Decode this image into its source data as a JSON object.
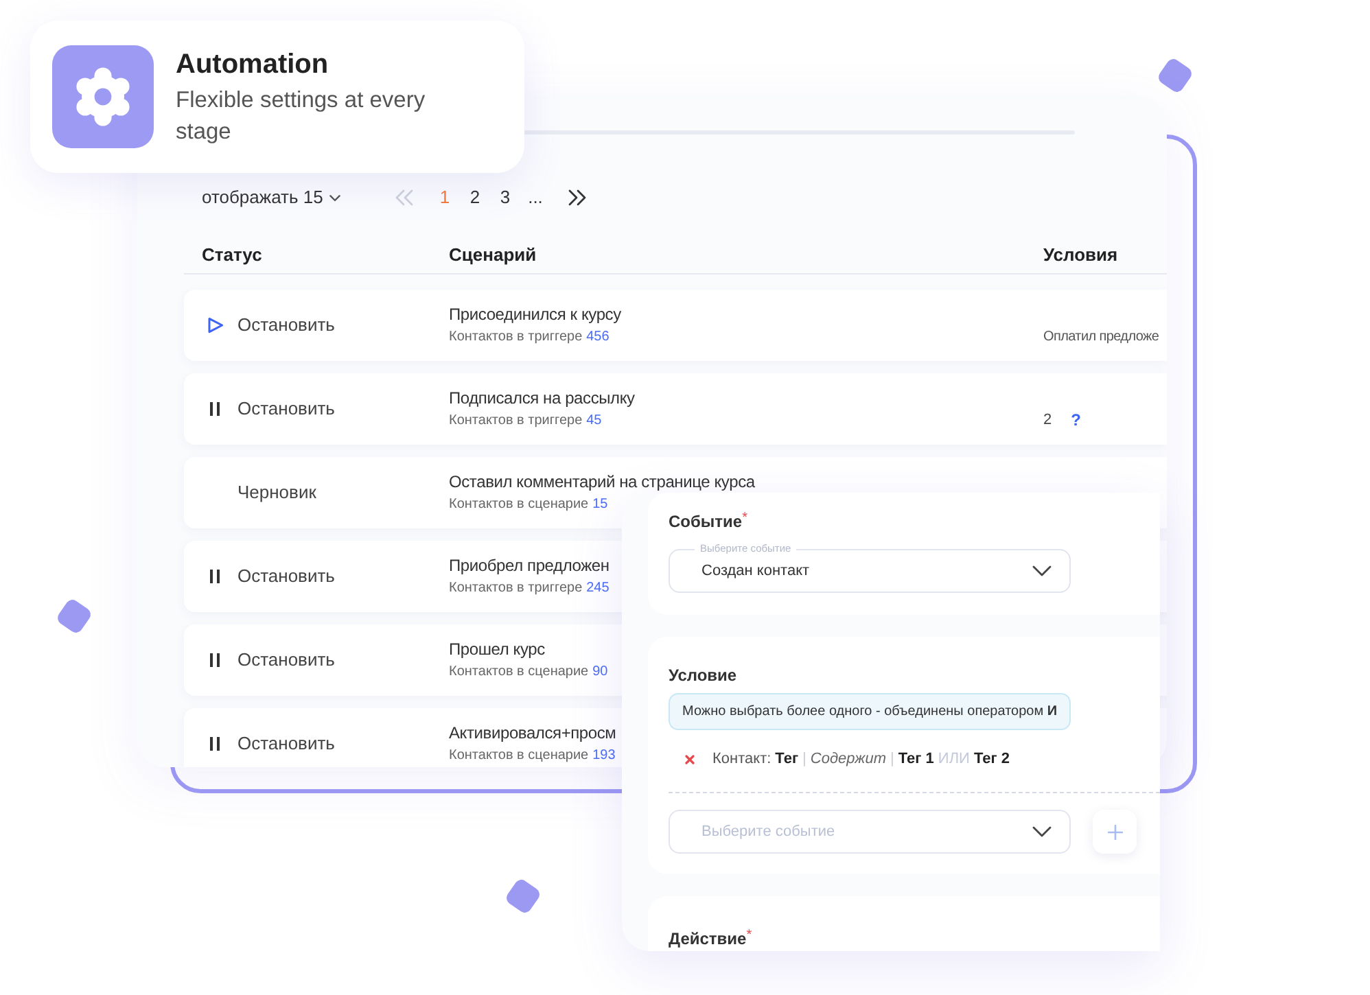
{
  "feature_card": {
    "title": "Automation",
    "subtitle": "Flexible settings at every stage"
  },
  "scenario_table": {
    "pagination": {
      "per_page": "отображать 15",
      "first_disabled": true,
      "last_disabled": false,
      "pages": [
        {
          "label": "1",
          "selected": true
        },
        {
          "label": "2",
          "selected": false
        },
        {
          "label": "3",
          "selected": false
        },
        {
          "label": "...",
          "selected": false
        }
      ]
    },
    "columns": [
      "Статус",
      "Сценарий",
      "Условия"
    ],
    "rows": [
      {
        "status": {
          "kind": "play",
          "label": "Остановить"
        },
        "title": "Присоединился к курсу",
        "counter_label": "Контактов в триггере",
        "counter_value": "456",
        "conditions": {
          "kind": "text",
          "text": "Оплатил предложе"
        }
      },
      {
        "status": {
          "kind": "pause",
          "label": "Остановить"
        },
        "title": "Подписался на рассылку",
        "counter_label": "Контактов в триггере",
        "counter_value": "45",
        "conditions": {
          "kind": "count",
          "count": "2",
          "help": "?"
        }
      },
      {
        "status": {
          "kind": "draft",
          "label": "Черновик"
        },
        "title": "Оставил комментарий на странице курса",
        "counter_label": "Контактов в сценарие",
        "counter_value": "15"
      },
      {
        "status": {
          "kind": "pause",
          "label": "Остановить"
        },
        "title": "Приобрел предложен",
        "counter_label": "Контактов в триггере",
        "counter_value": "245"
      },
      {
        "status": {
          "kind": "pause",
          "label": "Остановить"
        },
        "title": "Прошел курс",
        "counter_label": "Контактов в сценарие",
        "counter_value": "90"
      },
      {
        "status": {
          "kind": "pause",
          "label": "Остановить"
        },
        "title": "Активировался+просм",
        "counter_label": "Контактов в сценарие",
        "counter_value": "193"
      }
    ]
  },
  "rule_form": {
    "event_section": {
      "label": "Событие",
      "required_mark": "*",
      "select": {
        "floating_label": "Выберите событие",
        "value": "Создан контакт"
      }
    },
    "condition_section": {
      "label": "Условие",
      "hint": "Можно выбрать более одного - объединены оператором **И**",
      "conditions": [
        {
          "parts": [
            {
              "kind": "field",
              "text": "Контакт:"
            },
            {
              "kind": "value",
              "text": "Тег"
            },
            {
              "kind": "separator",
              "text": "|"
            },
            {
              "kind": "operator",
              "text": "Содержит"
            },
            {
              "kind": "separator",
              "text": "|"
            },
            {
              "kind": "value",
              "text": "Тег 1"
            },
            {
              "kind": "logic",
              "text": "ИЛИ"
            },
            {
              "kind": "value",
              "text": "Тег 2"
            }
          ]
        }
      ],
      "add_select": {
        "placeholder": "Выберите событие"
      }
    },
    "action_section": {
      "label": "Действие",
      "required_mark": "*"
    }
  }
}
